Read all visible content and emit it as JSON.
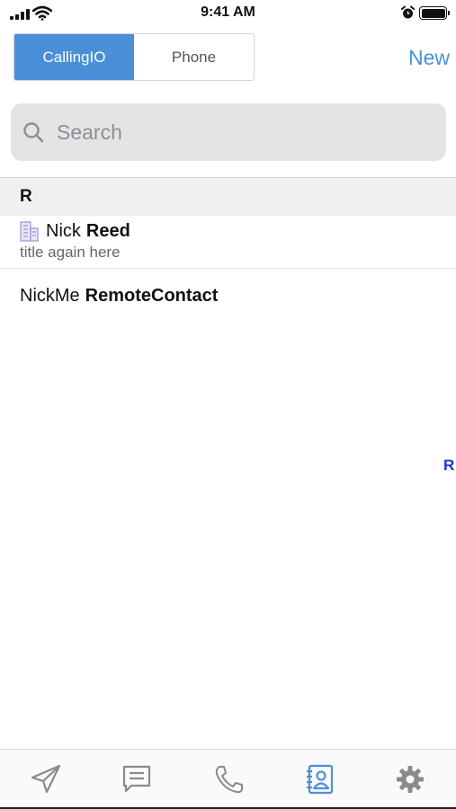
{
  "status_bar": {
    "time": "9:41 AM"
  },
  "segmented": {
    "items": [
      {
        "label": "CallingIO",
        "active": true
      },
      {
        "label": "Phone",
        "active": false
      }
    ]
  },
  "header": {
    "new_label": "New"
  },
  "search": {
    "placeholder": "Search"
  },
  "sections": [
    {
      "letter": "R",
      "contacts": [
        {
          "first_name": "Nick",
          "last_name": "Reed",
          "subtitle": "title again here",
          "icon": "building-icon"
        },
        {
          "first_name": "NickMe",
          "last_name": "RemoteContact"
        }
      ]
    }
  ],
  "section_index": [
    "R"
  ],
  "tab_bar": {
    "tabs": [
      {
        "icon": "paper-plane-icon",
        "active": false
      },
      {
        "icon": "message-icon",
        "active": false
      },
      {
        "icon": "phone-icon",
        "active": false
      },
      {
        "icon": "contacts-icon",
        "active": true
      },
      {
        "icon": "gear-icon",
        "active": false
      }
    ]
  },
  "colors": {
    "accent": "#4a90d9",
    "index_color": "#1a2fd0",
    "search_bg": "#e4e4e7",
    "section_bg": "#f0f0f2",
    "inactive_icon": "#8a8a8a"
  }
}
